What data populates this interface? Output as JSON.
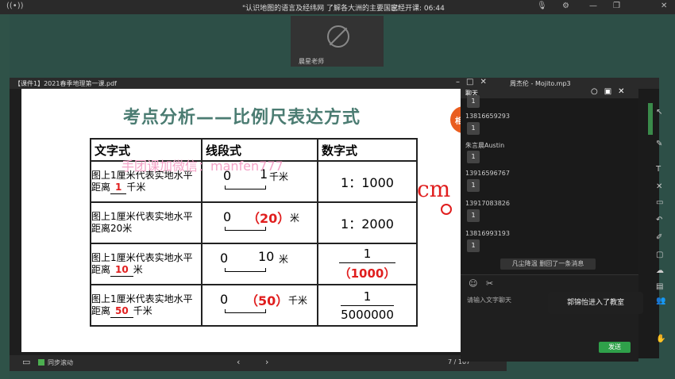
{
  "topbar": {
    "title": "\"认识地图的语言及经纬网 了解各大洲的主要国家\"",
    "timer": "已经开课: 06:44"
  },
  "teacher": {
    "name": "晨星老师"
  },
  "pdf": {
    "title": "【课件1】2021春季地理第一课.pdf",
    "footer": {
      "sync_label": "同步滚动",
      "page_current": "7",
      "page_total": "/ 107"
    }
  },
  "slide": {
    "heading": "考点分析——比例尺表达方式",
    "badge": "相",
    "headers": [
      "文字式",
      "线段式",
      "数字式"
    ],
    "rows": [
      {
        "desc_pre": "图上1厘米代表实地水平距离",
        "desc_fill": "1",
        "desc_unit": "千米",
        "scale_a": "0",
        "scale_b": "1",
        "scale_unit": "千米",
        "numeric": "1：1000"
      },
      {
        "desc_pre": "图上1厘米代表实地水平距离20米",
        "desc_fill": "",
        "desc_unit": "",
        "scale_a": "0",
        "scale_b": "（20）",
        "scale_unit": "米",
        "numeric": "1：2000"
      },
      {
        "desc_pre": "图上1厘米代表实地水平距离",
        "desc_fill": "10",
        "desc_unit": "米",
        "scale_a": "0",
        "scale_b": "10",
        "scale_unit": "米",
        "frac_num": "1",
        "frac_den": "（1000）"
      },
      {
        "desc_pre": "图上1厘米代表实地水平距离",
        "desc_fill": "50",
        "desc_unit": "千米",
        "scale_a": "0",
        "scale_b": "（50）",
        "scale_unit": "千米",
        "frac_num": "1",
        "frac_den": "5000000"
      }
    ],
    "watermark": "手团课加微信：manfen777",
    "annotation": "cm"
  },
  "mp3": {
    "title": "周杰伦 - Mojito.mp3"
  },
  "chat": {
    "title": "聊天",
    "messages": [
      {
        "user": "",
        "text": "1"
      },
      {
        "user": "13816659293",
        "text": "1"
      },
      {
        "user": "朱言晨Austin",
        "text": "1"
      },
      {
        "user": "13916596767",
        "text": "1"
      },
      {
        "user": "13917083826",
        "text": "1"
      },
      {
        "user": "13816993193",
        "text": "1"
      }
    ],
    "notice": "凡尘降温 删回了一条消息",
    "placeholder": "请输入文字聊天",
    "send_label": "发送"
  },
  "toast": "郭锦怡进入了教室"
}
